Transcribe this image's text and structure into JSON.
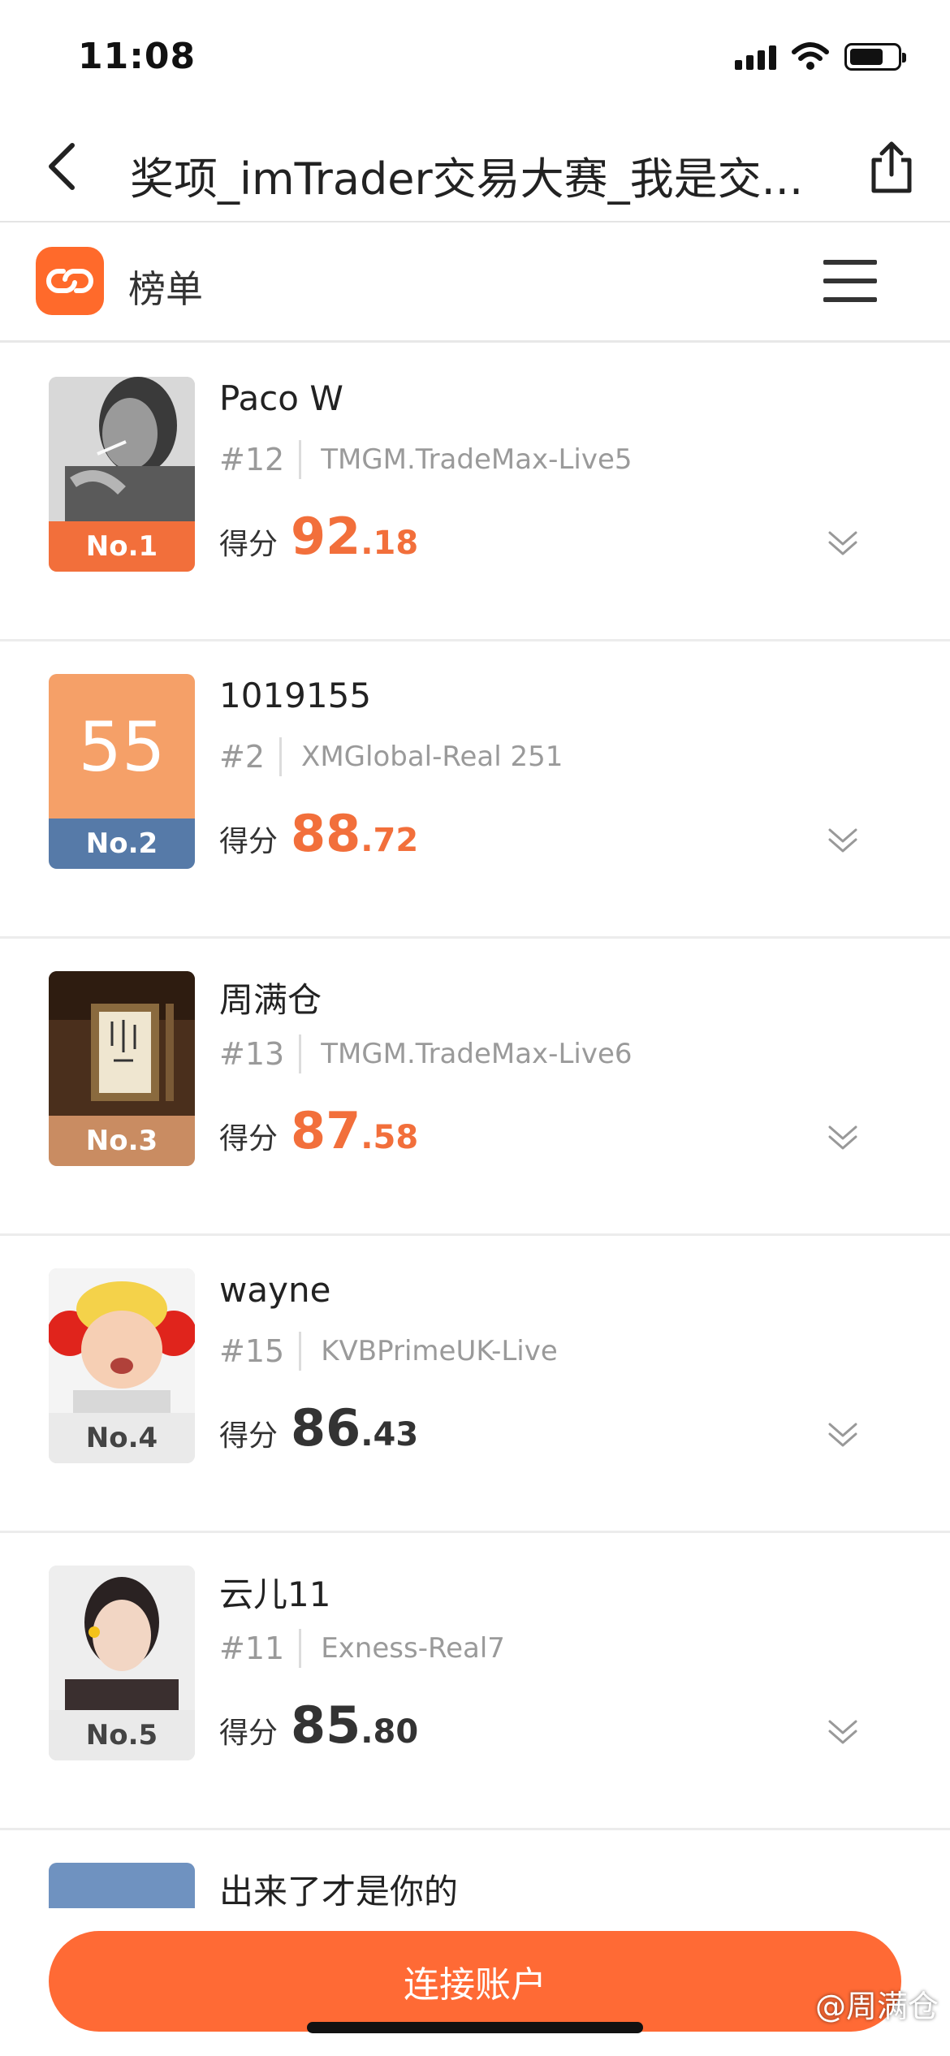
{
  "status_bar": {
    "time": "11:08"
  },
  "nav": {
    "title": "奖项_imTrader交易大赛_我是交..."
  },
  "section": {
    "title": "榜单"
  },
  "colors": {
    "accent": "#ff6a35",
    "gold_tag": "#f26f3b",
    "silver_tag": "#567aa8",
    "bronze_tag": "#c98c62"
  },
  "rows": [
    {
      "rank_tag": "No.1",
      "name": "Paco W",
      "sub_rank": "#12",
      "server": "TMGM.TradeMax-Live5",
      "score_label": "得分",
      "score_int": "92",
      "score_dec": ".18",
      "avatar_text": ""
    },
    {
      "rank_tag": "No.2",
      "name": "1019155",
      "sub_rank": "#2",
      "server": "XMGlobal-Real 251",
      "score_label": "得分",
      "score_int": "88",
      "score_dec": ".72",
      "avatar_text": "55"
    },
    {
      "rank_tag": "No.3",
      "name": "周满仓",
      "sub_rank": "#13",
      "server": "TMGM.TradeMax-Live6",
      "score_label": "得分",
      "score_int": "87",
      "score_dec": ".58",
      "avatar_text": ""
    },
    {
      "rank_tag": "No.4",
      "name": "wayne",
      "sub_rank": "#15",
      "server": "KVBPrimeUK-Live",
      "score_label": "得分",
      "score_int": "86",
      "score_dec": ".43",
      "avatar_text": ""
    },
    {
      "rank_tag": "No.5",
      "name": "云儿11",
      "sub_rank": "#11",
      "server": "Exness-Real7",
      "score_label": "得分",
      "score_int": "85",
      "score_dec": ".80",
      "avatar_text": ""
    },
    {
      "rank_tag": "",
      "name": "出来了才是你的",
      "sub_rank": "",
      "server": "",
      "score_label": "",
      "score_int": "",
      "score_dec": "",
      "avatar_text": ""
    }
  ],
  "bottom": {
    "connect_label": "连接账户"
  },
  "watermark": "@周满仓"
}
